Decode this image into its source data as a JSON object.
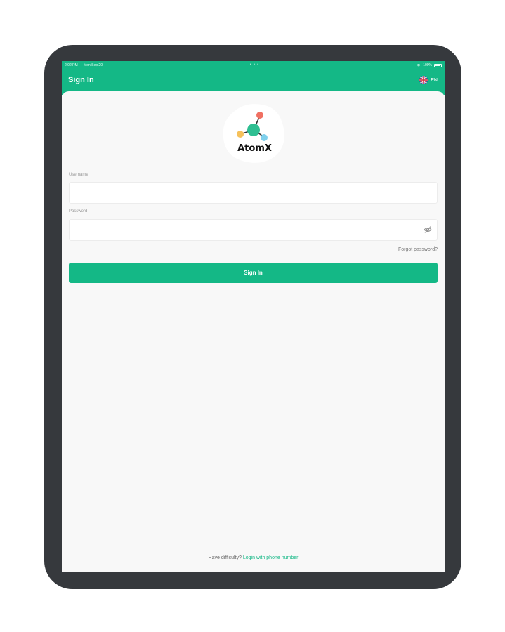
{
  "status_bar": {
    "time": "2:02 PM",
    "date": "Mon Sep 20",
    "dots": "• • •",
    "battery": "100%"
  },
  "header": {
    "title": "Sign In",
    "language": "EN"
  },
  "logo": {
    "text": "AtomX"
  },
  "form": {
    "username_label": "Username",
    "username_value": "",
    "password_label": "Password",
    "password_value": "",
    "forgot_label": "Forgot password?",
    "submit_label": "Sign In"
  },
  "footer": {
    "prompt": "Have difficulty?",
    "link": "Login with phone number"
  },
  "colors": {
    "brand": "#14b886",
    "frame": "#36393d",
    "background": "#f8f8f8"
  },
  "icons": {
    "language": "uk-flag-icon",
    "password_toggle": "eye-off-icon",
    "status_wifi": "wifi-icon",
    "status_battery": "battery-icon"
  }
}
